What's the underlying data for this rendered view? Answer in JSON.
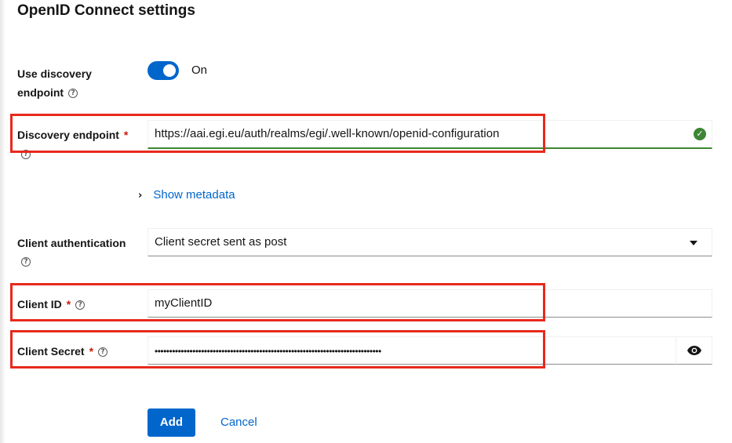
{
  "section": {
    "title": "OpenID Connect settings"
  },
  "discovery_toggle": {
    "label_line1": "Use discovery",
    "label_line2": "endpoint",
    "state_text": "On",
    "enabled": true
  },
  "discovery_endpoint": {
    "label": "Discovery endpoint",
    "required_marker": "*",
    "value": "https://aai.egi.eu/auth/realms/egi/.well-known/openid-configuration",
    "status": "success"
  },
  "metadata": {
    "toggle_label": "Show metadata"
  },
  "client_authentication": {
    "label": "Client authentication",
    "selected": "Client secret sent as post"
  },
  "client_id": {
    "label": "Client ID",
    "required_marker": "*",
    "value": "myClientID"
  },
  "client_secret": {
    "label": "Client Secret",
    "required_marker": "*",
    "masked_value": "••••••••••••••••••••••••••••••••••••••••••••••••••••••••••••••••••••••••••••••"
  },
  "actions": {
    "add_label": "Add",
    "cancel_label": "Cancel"
  },
  "icons": {
    "help": "help-circle-icon",
    "success": "check-circle-icon",
    "caret": "caret-down-icon",
    "chevron": "chevron-right-icon",
    "eye": "eye-icon"
  },
  "colors": {
    "primary": "#0066cc",
    "success": "#3e8635",
    "required": "#c9190b",
    "highlight": "#e8291c"
  }
}
